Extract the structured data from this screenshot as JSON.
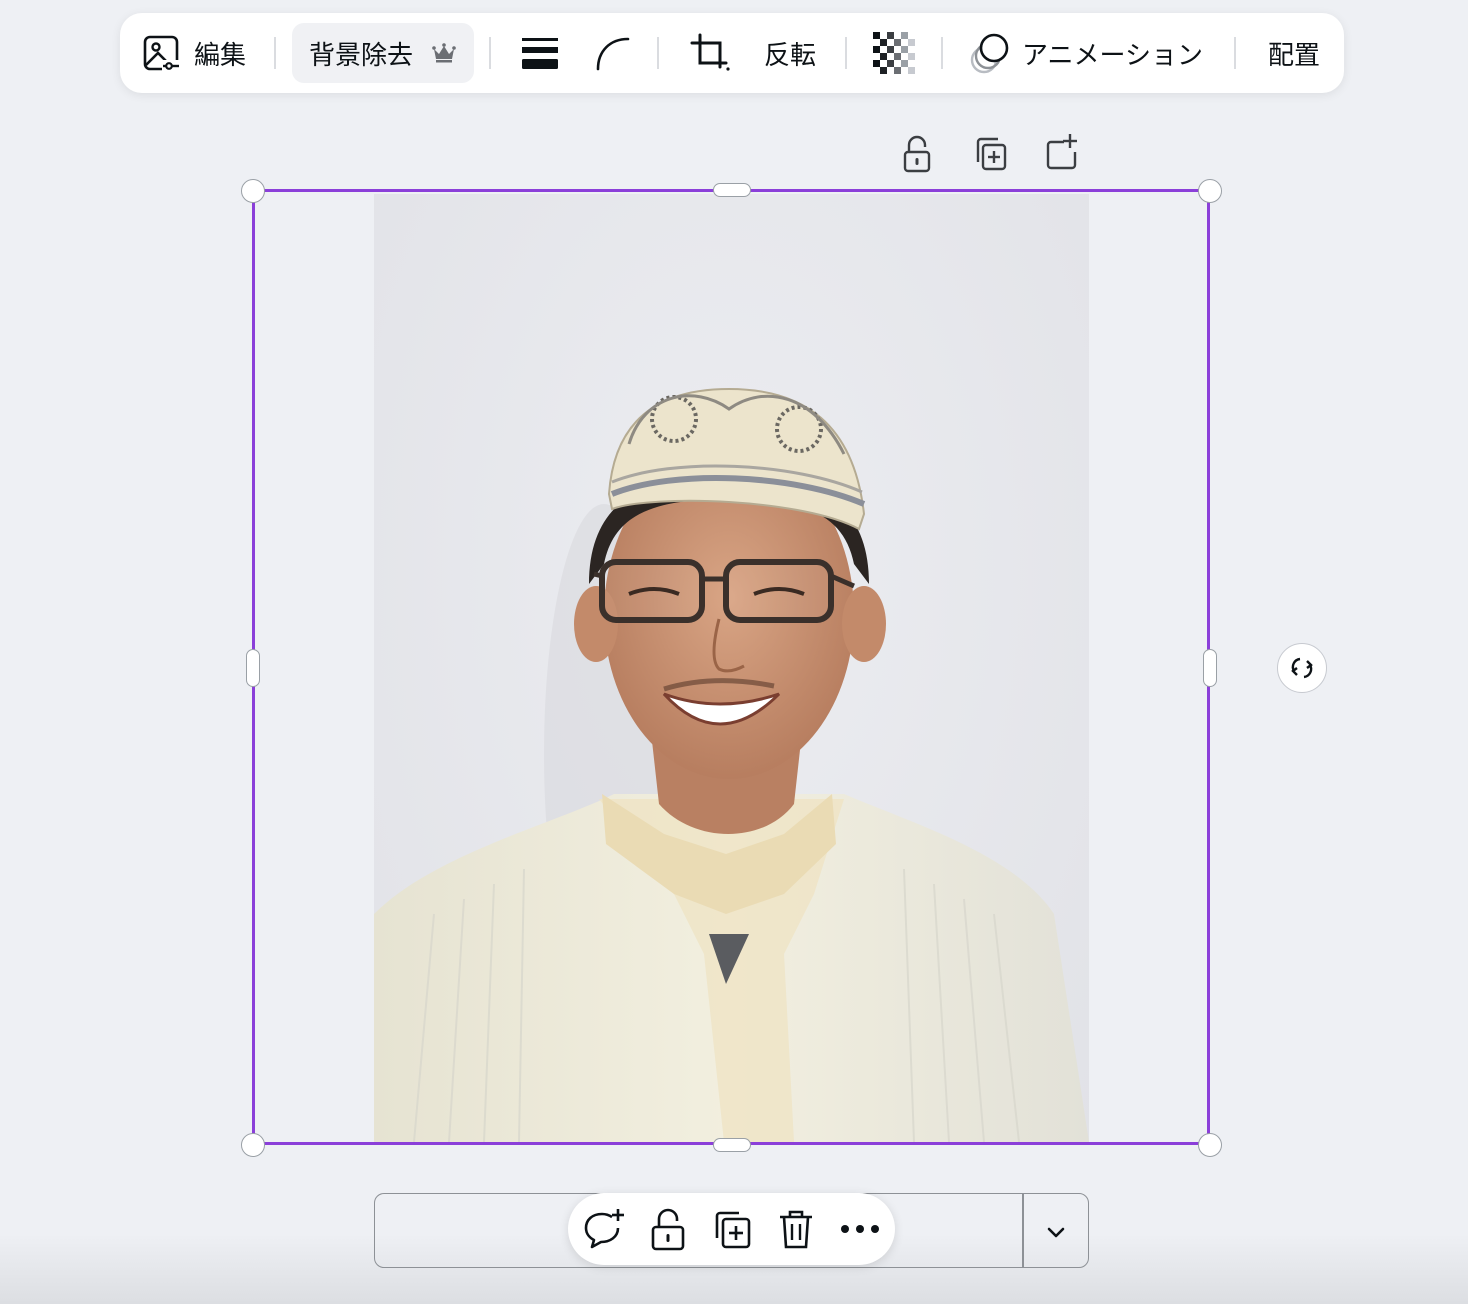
{
  "toolbar": {
    "edit_label": "編集",
    "bg_remove_label": "背景除去",
    "flip_label": "反転",
    "animation_label": "アニメーション",
    "position_label": "配置"
  },
  "icons": {
    "edit": "image-edit-icon",
    "premium": "crown-icon",
    "border_style": "border-style-icon",
    "corner_rounding": "corner-rounding-icon",
    "crop": "crop-icon",
    "transparency": "transparency-checker-icon",
    "animation": "animation-icon",
    "lock": "unlock-icon",
    "duplicate": "duplicate-icon",
    "add_page": "add-page-icon",
    "rotate": "rotate-icon",
    "comment": "add-comment-icon",
    "trash": "trash-icon",
    "more": "more-icon",
    "chevron": "chevron-down-icon"
  },
  "colors": {
    "selection": "#8b3fd9",
    "toolbar_bg": "#ffffff",
    "canvas_bg": "#eef0f4"
  }
}
